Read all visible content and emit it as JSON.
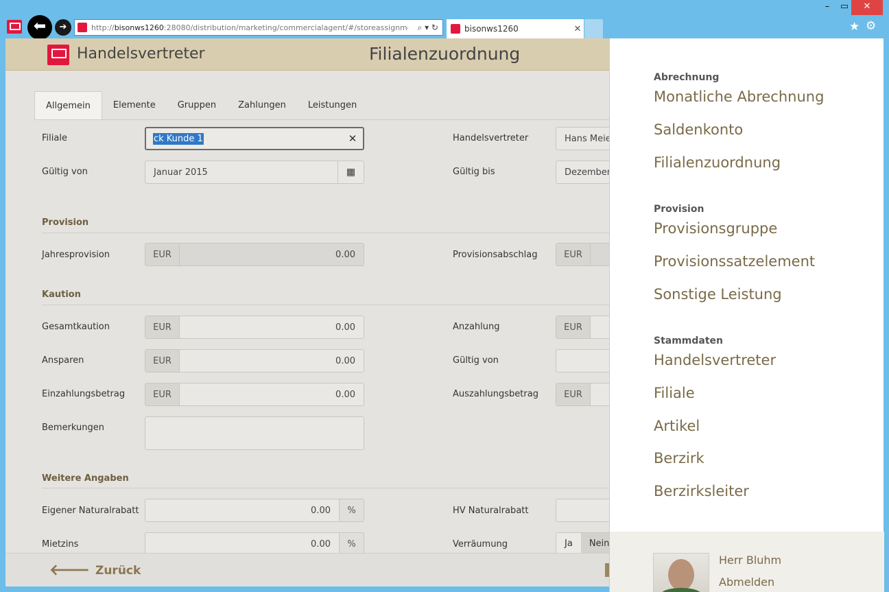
{
  "browser": {
    "url_prefix": "http://",
    "url_host": "bisonws1260",
    "url_rest": ":28080/distribution/marketing/commercialagent/#/storeassignmen",
    "tab_title": "bisonws1260",
    "tools": "⌕ ▾ ↻",
    "minimize": "–",
    "maximize": "▭",
    "close": "✕",
    "star": "★",
    "gear": "⚙",
    "back": "⬅",
    "forward": "➔"
  },
  "header": {
    "app_name": "Handelsvertreter",
    "page_title": "Filialenzuordnung"
  },
  "tabs": [
    "Allgemein",
    "Elemente",
    "Gruppen",
    "Zahlungen",
    "Leistungen"
  ],
  "form": {
    "filiale_label": "Filiale",
    "filiale_value": "ck Kunde 1",
    "clear_icon": "✕",
    "handelsvertreter_label": "Handelsvertreter",
    "handelsvertreter_value": "Hans Meier",
    "gueltig_von_label": "Gültig von",
    "gueltig_von_value": "Januar 2015",
    "calendar_icon": "▦",
    "gueltig_bis_label": "Gültig bis",
    "gueltig_bis_value": "Dezember"
  },
  "provision": {
    "title": "Provision",
    "jahresprovision_label": "Jahresprovision",
    "jahresprovision_value": "0.00",
    "provisionsabschlag_label": "Provisionsabschlag"
  },
  "kaution": {
    "title": "Kaution",
    "gesamtkaution_label": "Gesamtkaution",
    "gesamtkaution_value": "0.00",
    "anzahlung_label": "Anzahlung",
    "ansparen_label": "Ansparen",
    "ansparen_value": "0.00",
    "gueltig_von_label": "Gültig von",
    "einzahlungsbetrag_label": "Einzahlungsbetrag",
    "einzahlungsbetrag_value": "0.00",
    "auszahlungsbetrag_label": "Auszahlungsbetrag",
    "bemerkungen_label": "Bemerkungen"
  },
  "weitere": {
    "title": "Weitere Angaben",
    "eigener_label": "Eigener Naturalrabatt",
    "eigener_value": "0.00",
    "hv_label": "HV Naturalrabatt",
    "mietzins_label": "Mietzins",
    "mietzins_value": "0.00",
    "verraeumung_label": "Verräumung",
    "ja": "Ja",
    "nein": "Nein"
  },
  "units": {
    "currency": "EUR",
    "percent": "%"
  },
  "footer": {
    "back_label": "Zurück",
    "back_icon": "🡐"
  },
  "menu": {
    "abrechnung": {
      "title": "Abrechnung",
      "items": [
        "Monatliche Abrechnung",
        "Saldenkonto",
        "Filialenzuordnung"
      ]
    },
    "provision": {
      "title": "Provision",
      "items": [
        "Provisionsgruppe",
        "Provisionssatzelement",
        "Sonstige Leistung"
      ]
    },
    "stammdaten": {
      "title": "Stammdaten",
      "items": [
        "Handelsvertreter",
        "Filiale",
        "Artikel",
        "Berzirk",
        "Berzirksleiter"
      ]
    },
    "user": {
      "name": "Herr Bluhm",
      "logout": "Abmelden"
    }
  }
}
